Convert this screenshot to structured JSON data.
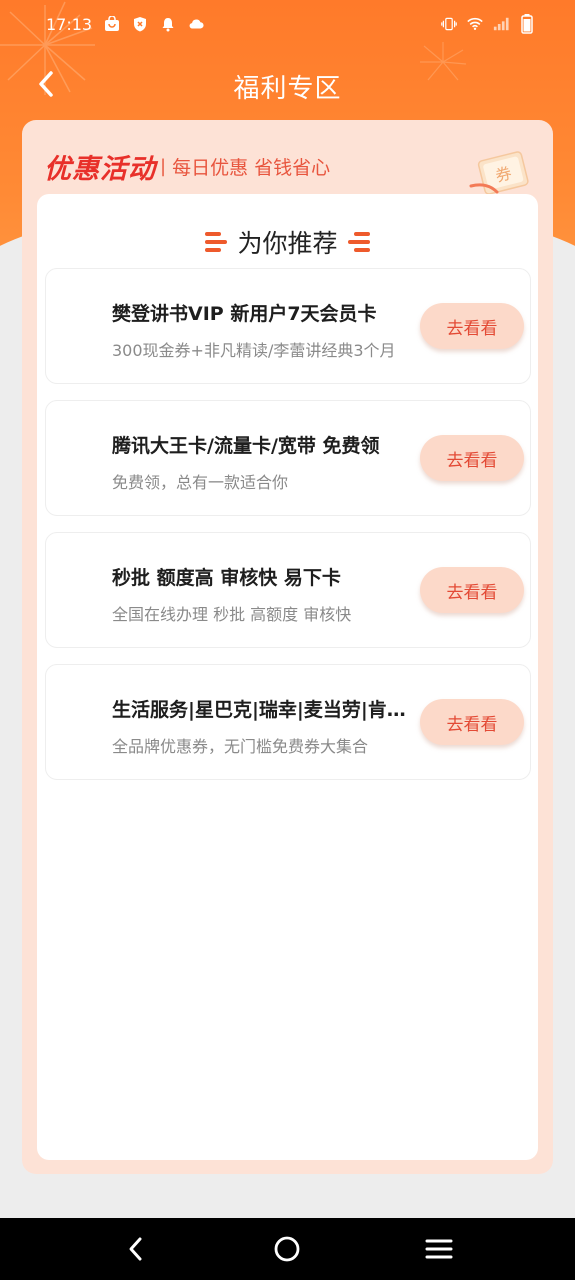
{
  "status_bar": {
    "time": "17:13",
    "left_icons": [
      "shopping-bag-icon",
      "shield-x-icon",
      "bell-icon",
      "cloud-icon"
    ],
    "right_icons": [
      "vibrate-icon",
      "wifi-icon",
      "signal-icon",
      "battery-icon"
    ]
  },
  "nav": {
    "title": "福利专区"
  },
  "promo": {
    "title": "优惠活动",
    "separator": "|",
    "subtitle": "每日优惠 省钱省心",
    "ticket_icon": "coupon-ticket-icon"
  },
  "recommend": {
    "title": "为你推荐",
    "items": [
      {
        "title": "樊登讲书VIP 新用户7天会员卡",
        "desc": "300现金券+非凡精读/李蕾讲经典3个月",
        "button": "去看看"
      },
      {
        "title": "腾讯大王卡/流量卡/宽带 免费领",
        "desc": "免费领，总有一款适合你",
        "button": "去看看"
      },
      {
        "title": "秒批 额度高 审核快 易下卡",
        "desc": "全国在线办理 秒批 高额度 审核快",
        "button": "去看看"
      },
      {
        "title": "生活服务|星巴克|瑞幸|麦当劳|肯德基",
        "desc": "全品牌优惠券，无门槛免费券大集合",
        "button": "去看看"
      }
    ]
  },
  "colors": {
    "header_orange": "#ff7a2a",
    "promo_red": "#e8302a",
    "button_bg": "#fcd9c9",
    "button_text": "#e34a35"
  }
}
